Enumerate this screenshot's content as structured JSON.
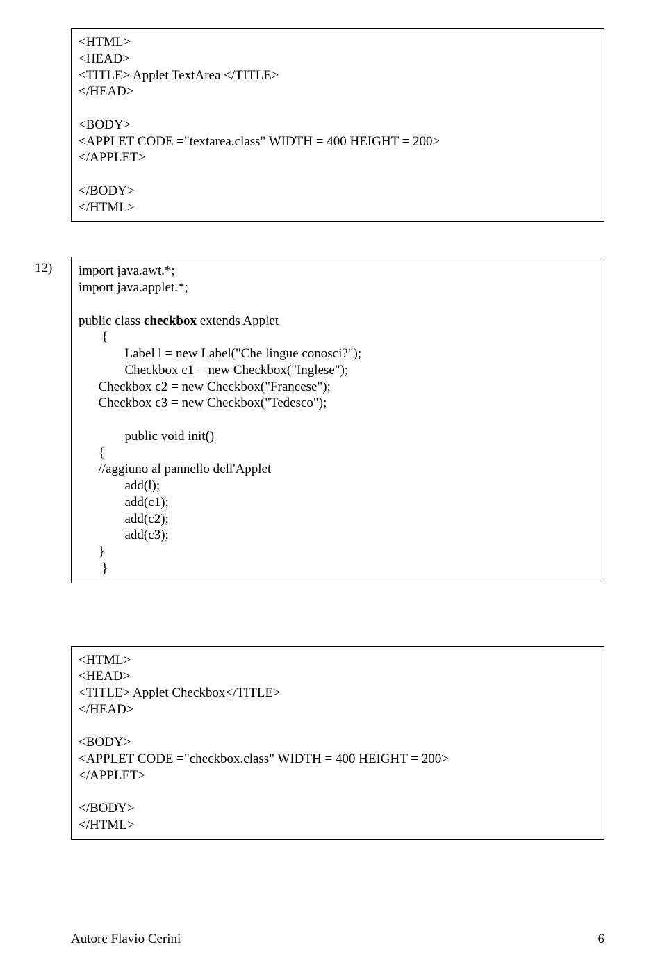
{
  "box1": {
    "l1": "<HTML>",
    "l2": "<HEAD>",
    "l3": "<TITLE> Applet TextArea </TITLE>",
    "l4": "</HEAD>",
    "l6": "<BODY>",
    "l7": "<APPLET CODE =\"textarea.class\" WIDTH = 400 HEIGHT = 200>",
    "l8": "</APPLET>",
    "l10": "</BODY>",
    "l11": "</HTML>"
  },
  "item_num": "12)",
  "box2": {
    "l1": "import java.awt.*;",
    "l2": "import java.applet.*;",
    "l4a": "public class ",
    "l4b": "checkbox",
    "l4c": " extends Applet",
    "l5": "       {",
    "l6": "              Label l = new Label(\"Che lingue conosci?\");",
    "l7": "              Checkbox c1 = new Checkbox(\"Inglese\");",
    "l8": "      Checkbox c2 = new Checkbox(\"Francese\");",
    "l9": "      Checkbox c3 = new Checkbox(\"Tedesco\");",
    "l11": "              public void init()",
    "l12": "      {",
    "l13": "      //aggiuno al pannello dell'Applet",
    "l14": "              add(l);",
    "l15": "              add(c1);",
    "l16": "              add(c2);",
    "l17": "              add(c3);",
    "l18": "      }",
    "l19": "       }"
  },
  "box3": {
    "l1": "<HTML>",
    "l2": "<HEAD>",
    "l3": "<TITLE> Applet Checkbox</TITLE>",
    "l4": "</HEAD>",
    "l6": "<BODY>",
    "l7": "<APPLET CODE =\"checkbox.class\" WIDTH = 400 HEIGHT = 200>",
    "l8": "</APPLET>",
    "l10": "</BODY>",
    "l11": "</HTML>"
  },
  "footer": {
    "author": "Autore Flavio Cerini",
    "page": "6"
  }
}
